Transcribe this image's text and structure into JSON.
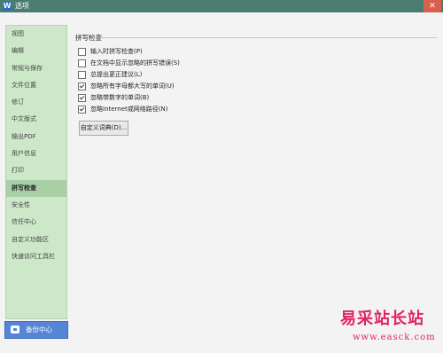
{
  "window": {
    "title": "选项",
    "app_icon": "W"
  },
  "sidebar": {
    "items": [
      {
        "label": "视图"
      },
      {
        "label": "编辑"
      },
      {
        "label": "常规与保存"
      },
      {
        "label": "文件位置"
      },
      {
        "label": "修订"
      },
      {
        "label": "中文版式"
      },
      {
        "label": "输出PDF"
      },
      {
        "label": "用户信息"
      },
      {
        "label": "打印"
      },
      {
        "label": "拼写检查",
        "active": true
      },
      {
        "label": "安全性"
      },
      {
        "label": "信任中心"
      },
      {
        "label": "自定义功能区"
      },
      {
        "label": "快速访问工具栏"
      }
    ],
    "backup_label": "备份中心"
  },
  "main": {
    "section_title": "拼写检查",
    "options": [
      {
        "label": "输入时拼写检查(P)",
        "checked": false
      },
      {
        "label": "在文档中显示忽略的拼写错误(S)",
        "checked": false
      },
      {
        "label": "总提出更正建议(L)",
        "checked": false
      },
      {
        "label": "忽略所有字母都大写的单词(U)",
        "checked": true
      },
      {
        "label": "忽略带数字的单词(B)",
        "checked": true
      },
      {
        "label": "忽略Internet或网络路径(N)",
        "checked": true
      }
    ],
    "custom_dict_label": "自定义词典(D)..."
  },
  "watermark": {
    "text": "易采站长站",
    "url": "www.easck.com"
  },
  "colors": {
    "titlebar": "#4a7d70",
    "sidebar": "#cde8c9",
    "accent": "#5585d4",
    "watermark": "#e0245e"
  }
}
